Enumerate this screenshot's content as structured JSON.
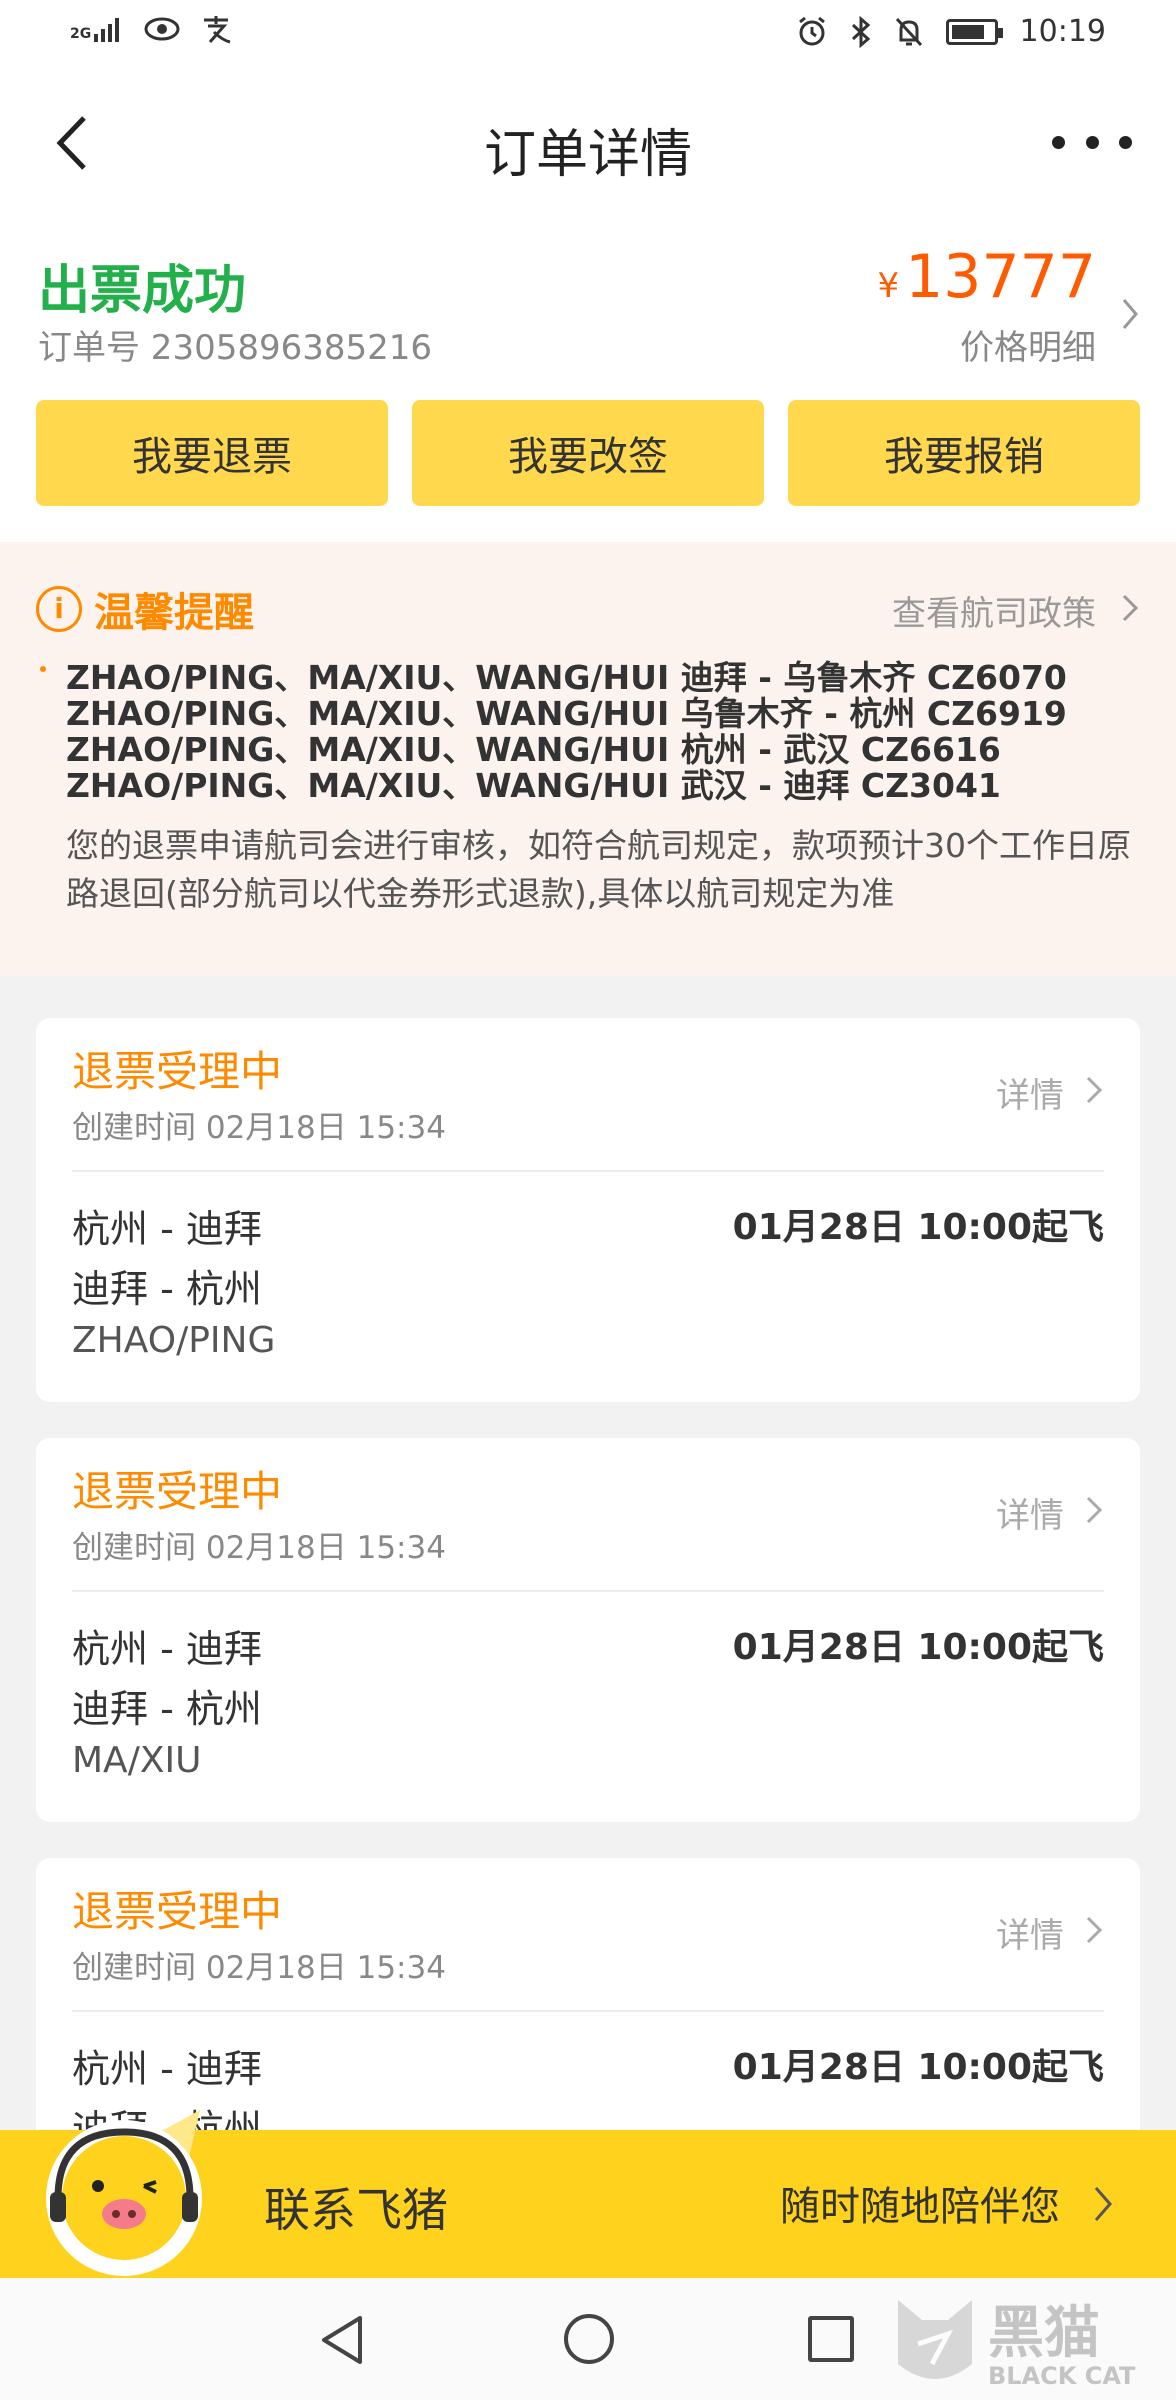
{
  "status_bar": {
    "signal": "2G",
    "time": "10:19",
    "battery_level_percent": 80
  },
  "nav": {
    "title": "订单详情"
  },
  "order": {
    "status": "出票成功",
    "order_no_label": "订单号 2305896385216",
    "currency_symbol": "¥",
    "price": "13777",
    "price_detail_label": "价格明细",
    "actions": [
      "我要退票",
      "我要改签",
      "我要报销"
    ]
  },
  "notice": {
    "title": "温馨提醒",
    "policy_link": "查看航司政策",
    "flights": [
      "ZHAO/PING、MA/XIU、WANG/HUI 迪拜 - 乌鲁木齐 CZ6070",
      "ZHAO/PING、MA/XIU、WANG/HUI 乌鲁木齐 - 杭州 CZ6919",
      "ZHAO/PING、MA/XIU、WANG/HUI 杭州 - 武汉 CZ6616",
      "ZHAO/PING、MA/XIU、WANG/HUI 武汉 - 迪拜 CZ3041"
    ],
    "text": "您的退票申请航司会进行审核，如符合航司规定，款项预计30个工作日原路退回(部分航司以代金券形式退款),具体以航司规定为准"
  },
  "refunds": [
    {
      "status": "退票受理中",
      "created": "创建时间 02月18日 15:34",
      "detail_label": "详情",
      "route1": "杭州 - 迪拜",
      "route2": "迪拜 - 杭州",
      "passenger": "ZHAO/PING",
      "departure": "01月28日 10:00起飞"
    },
    {
      "status": "退票受理中",
      "created": "创建时间 02月18日 15:34",
      "detail_label": "详情",
      "route1": "杭州 - 迪拜",
      "route2": "迪拜 - 杭州",
      "passenger": "MA/XIU",
      "departure": "01月28日 10:00起飞"
    },
    {
      "status": "退票受理中",
      "created": "创建时间 02月18日 15:34",
      "detail_label": "详情",
      "route1": "杭州 - 迪拜",
      "route2": "迪拜 - 杭州",
      "passenger": "",
      "departure": "01月28日 10:00起飞"
    }
  ],
  "contact": {
    "label": "联系飞猪",
    "sub": "随时随地陪伴您"
  },
  "watermark": {
    "text_cn": "黑猫",
    "text_en": "BLACK CAT"
  },
  "colors": {
    "accent_yellow": "#ffd84e",
    "success_green": "#22b04b",
    "price_orange": "#ff5a00",
    "notice_orange": "#ff8a00",
    "contact_yellow": "#ffd21e"
  }
}
